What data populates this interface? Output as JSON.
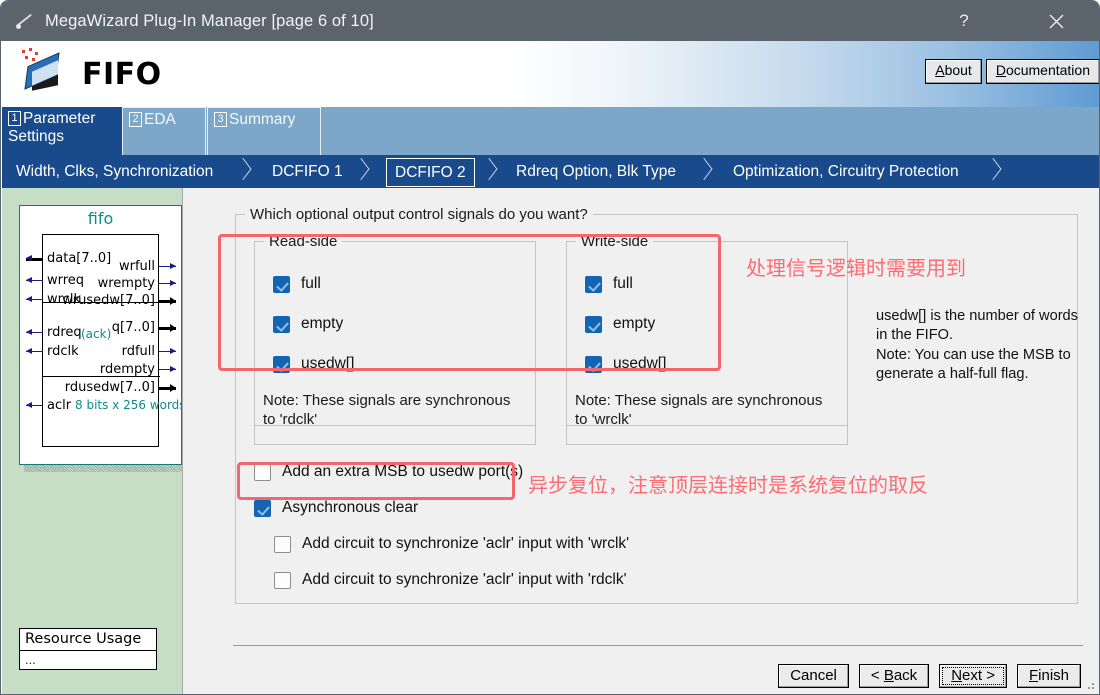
{
  "window": {
    "title": "MegaWizard Plug-In Manager [page 6 of 10]",
    "icon": "wand-icon",
    "help_label": "?",
    "close_label": "✕"
  },
  "header": {
    "brand": "FIFO",
    "logo_icon": "altera-chip-icon",
    "about_label": "About",
    "about_accel": "A",
    "documentation_label": "Documentation",
    "documentation_accel": "D"
  },
  "tabs": [
    {
      "num": "1",
      "label": "Parameter Settings",
      "selected": true
    },
    {
      "num": "2",
      "label": "EDA",
      "selected": false
    },
    {
      "num": "3",
      "label": "Summary",
      "selected": false
    }
  ],
  "breadcrumbs": [
    {
      "label": "Width, Clks, Synchronization",
      "selected": false
    },
    {
      "label": "DCFIFO 1",
      "selected": false
    },
    {
      "label": "DCFIFO 2",
      "selected": true
    },
    {
      "label": "Rdreq Option, Blk Type",
      "selected": false
    },
    {
      "label": "Optimization, Circuitry Protection",
      "selected": false
    }
  ],
  "diagram": {
    "title": "fifo",
    "left_ports": [
      "data[7..0]",
      "wrreq",
      "wrclk",
      "rdreq",
      "rdclk",
      "aclr"
    ],
    "right_ports": [
      "wrfull",
      "wrempty",
      "wrusedw[7..0]",
      "q[7..0]",
      "rdfull",
      "rdempty",
      "rdusedw[7..0]"
    ],
    "annotation_ack": "(ack)",
    "annotation_q": "q",
    "size_label": "8 bits x 256 words"
  },
  "resource": {
    "title": "Resource Usage",
    "body": "..."
  },
  "main": {
    "question": "Which optional output control signals do you want?",
    "read_group": {
      "label": "Read-side",
      "options": [
        {
          "label": "full",
          "checked": true
        },
        {
          "label": "empty",
          "checked": true
        },
        {
          "label": "usedw[]",
          "checked": true
        }
      ],
      "note": "Note: These signals are synchronous to 'rdclk'"
    },
    "write_group": {
      "label": "Write-side",
      "options": [
        {
          "label": "full",
          "checked": true
        },
        {
          "label": "empty",
          "checked": true
        },
        {
          "label": "usedw[]",
          "checked": true
        }
      ],
      "note": "Note: These signals are synchronous to 'wrclk'"
    },
    "info_text": "usedw[] is the number of words in the FIFO.\nNote: You can use the MSB to generate a half-full flag.",
    "bottom_options": [
      {
        "label": "Add an extra MSB to usedw port(s)",
        "checked": false
      },
      {
        "label": "Asynchronous clear",
        "checked": true
      },
      {
        "label": "Add circuit to synchronize 'aclr' input with 'wrclk'",
        "checked": false
      },
      {
        "label": "Add circuit to synchronize 'aclr' input with 'rdclk'",
        "checked": false
      }
    ]
  },
  "annotations": [
    {
      "text": "处理信号逻辑时需要用到",
      "color": "#fa6d75"
    },
    {
      "text": "异步复位，注意顶层连接时是系统复位的取反",
      "color": "#fa6d75"
    }
  ],
  "footer": {
    "buttons": [
      {
        "label": "Cancel",
        "accel": "",
        "focused": false
      },
      {
        "label": "< Back",
        "accel": "B",
        "focused": false
      },
      {
        "label": "Next >",
        "accel": "N",
        "focused": true
      },
      {
        "label": "Finish",
        "accel": "F",
        "focused": false
      }
    ]
  },
  "colors": {
    "titlebar": "#5b646d",
    "tab_selected": "#184a8c",
    "tab_bar": "#7da7c8",
    "left_panel": "#c7dec6",
    "checkbox_on": "#1464b4",
    "annotation_red": "#fa6d75",
    "diagram_teal": "#0e8c8c"
  }
}
